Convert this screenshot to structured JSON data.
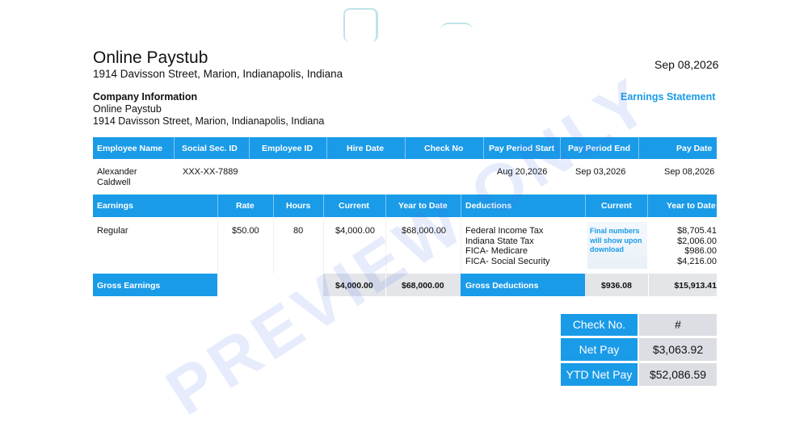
{
  "header": {
    "title": "Online Paystub",
    "address": "1914 Davisson Street, Marion, Indianapolis, Indiana",
    "date": "Sep 08,2026"
  },
  "company": {
    "heading": "Company Information",
    "name": "Online Paystub",
    "address": "1914 Davisson Street, Marion, Indianapolis, Indiana",
    "statement_label": "Earnings Statement"
  },
  "employee_table": {
    "headers": [
      "Employee Name",
      "Social Sec. ID",
      "Employee ID",
      "Hire Date",
      "Check No",
      "Pay Period Start",
      "Pay Period End",
      "Pay Date"
    ],
    "row": {
      "name_line1": "Alexander",
      "name_line2": "Caldwell",
      "ssn": "XXX-XX-7889",
      "employee_id": "",
      "hire_date": "",
      "check_no": "",
      "period_start": "Aug 20,2026",
      "period_end": "Sep 03,2026",
      "pay_date": "Sep 08,2026"
    }
  },
  "earnings_table": {
    "headers": [
      "Earnings",
      "Rate",
      "Hours",
      "Current",
      "Year to Date",
      "Deductions",
      "Current",
      "Year to Date"
    ],
    "earning_row": {
      "type": "Regular",
      "rate": "$50.00",
      "hours": "80",
      "current": "$4,000.00",
      "ytd": "$68,000.00"
    },
    "deductions": [
      "Federal Income Tax",
      "Indiana State Tax",
      "FICA- Medicare",
      "FICA- Social Security"
    ],
    "deductions_ytd": [
      "$8,705.41",
      "$2,006.00",
      "$986.00",
      "$4,216.00"
    ],
    "notice": [
      "Final numbers",
      "will show upon",
      "download"
    ],
    "gross_earnings_label": "Gross Earnings",
    "gross_current": "$4,000.00",
    "gross_ytd": "$68,000.00",
    "gross_deductions_label": "Gross Deductions",
    "deductions_current_total": "$936.08",
    "deductions_ytd_total": "$15,913.41"
  },
  "summary": {
    "check_no_label": "Check No.",
    "check_no_value": "#",
    "net_pay_label": "Net Pay",
    "net_pay_value": "$3,063.92",
    "ytd_net_pay_label": "YTD Net Pay",
    "ytd_net_pay_value": "$52,086.59"
  },
  "watermark": "PREVIEW ONLY",
  "colors": {
    "accent": "#1a9be8",
    "band_gray": "#e3e5e9"
  }
}
